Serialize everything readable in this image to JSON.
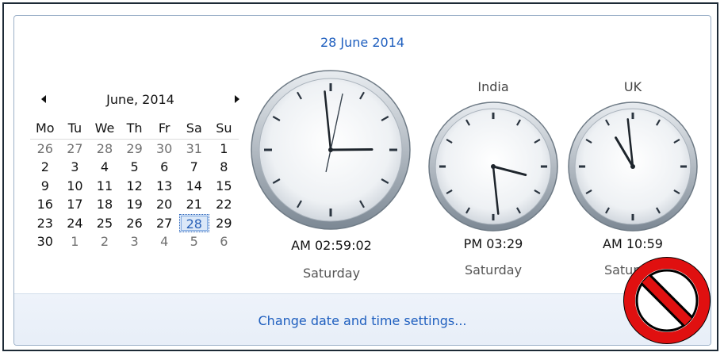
{
  "header": {
    "date": "28 June 2014"
  },
  "calendar": {
    "month_title": "June, 2014",
    "weekdays": [
      "Mo",
      "Tu",
      "We",
      "Th",
      "Fr",
      "Sa",
      "Su"
    ],
    "weeks": [
      [
        {
          "d": "26",
          "o": true
        },
        {
          "d": "27",
          "o": true
        },
        {
          "d": "28",
          "o": true
        },
        {
          "d": "29",
          "o": true
        },
        {
          "d": "30",
          "o": true
        },
        {
          "d": "31",
          "o": true
        },
        {
          "d": "1"
        }
      ],
      [
        {
          "d": "2"
        },
        {
          "d": "3"
        },
        {
          "d": "4"
        },
        {
          "d": "5"
        },
        {
          "d": "6"
        },
        {
          "d": "7"
        },
        {
          "d": "8"
        }
      ],
      [
        {
          "d": "9"
        },
        {
          "d": "10"
        },
        {
          "d": "11"
        },
        {
          "d": "12"
        },
        {
          "d": "13"
        },
        {
          "d": "14"
        },
        {
          "d": "15"
        }
      ],
      [
        {
          "d": "16"
        },
        {
          "d": "17"
        },
        {
          "d": "18"
        },
        {
          "d": "19"
        },
        {
          "d": "20"
        },
        {
          "d": "21"
        },
        {
          "d": "22"
        }
      ],
      [
        {
          "d": "23"
        },
        {
          "d": "24"
        },
        {
          "d": "25"
        },
        {
          "d": "26"
        },
        {
          "d": "27"
        },
        {
          "d": "28",
          "t": true
        },
        {
          "d": "29"
        }
      ],
      [
        {
          "d": "30"
        },
        {
          "d": "1",
          "o": true
        },
        {
          "d": "2",
          "o": true
        },
        {
          "d": "3",
          "o": true
        },
        {
          "d": "4",
          "o": true
        },
        {
          "d": "5",
          "o": true
        },
        {
          "d": "6",
          "o": true
        }
      ]
    ]
  },
  "clocks": [
    {
      "label": "",
      "time": "AM 02:59:02",
      "day": "Saturday",
      "hour": 2,
      "minute": 59,
      "second": 2
    },
    {
      "label": "India",
      "time": "PM 03:29",
      "day": "Saturday",
      "hour": 3,
      "minute": 29
    },
    {
      "label": "UK",
      "time": "AM 10:59",
      "day": "Saturday",
      "hour": 10,
      "minute": 59
    }
  ],
  "footer": {
    "link": "Change date and time settings..."
  },
  "icons": {
    "prev": "chevron-left-icon",
    "next": "chevron-right-icon",
    "overlay": "prohibited-icon"
  },
  "colors": {
    "accent": "#1f5fbf",
    "prohibit": "#e01010"
  }
}
